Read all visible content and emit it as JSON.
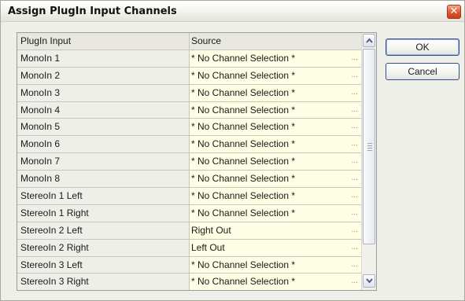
{
  "window": {
    "title": "Assign PlugIn Input Channels",
    "close_glyph": "✕"
  },
  "grid": {
    "headers": {
      "input": "PlugIn Input",
      "source": "Source"
    },
    "ellipsis": "...",
    "rows": [
      {
        "input": "MonoIn 1",
        "source": "* No Channel Selection *"
      },
      {
        "input": "MonoIn 2",
        "source": "* No Channel Selection *"
      },
      {
        "input": "MonoIn 3",
        "source": "* No Channel Selection *"
      },
      {
        "input": "MonoIn 4",
        "source": "* No Channel Selection *"
      },
      {
        "input": "MonoIn 5",
        "source": "* No Channel Selection *"
      },
      {
        "input": "MonoIn 6",
        "source": "* No Channel Selection *"
      },
      {
        "input": "MonoIn 7",
        "source": "* No Channel Selection *"
      },
      {
        "input": "MonoIn 8",
        "source": "* No Channel Selection *"
      },
      {
        "input": "StereoIn 1 Left",
        "source": "* No Channel Selection *"
      },
      {
        "input": "StereoIn 1 Right",
        "source": "* No Channel Selection *"
      },
      {
        "input": "StereoIn 2 Left",
        "source": "Right Out"
      },
      {
        "input": "StereoIn 2 Right",
        "source": "Left Out"
      },
      {
        "input": "StereoIn 3 Left",
        "source": "* No Channel Selection *"
      },
      {
        "input": "StereoIn 3 Right",
        "source": "* No Channel Selection *"
      }
    ]
  },
  "buttons": {
    "ok": "OK",
    "cancel": "Cancel"
  },
  "icons": {
    "scroll_up": "chevron-up-icon",
    "scroll_down": "chevron-down-icon",
    "close": "close-icon"
  },
  "colors": {
    "source_cell_bg": "#fefee4",
    "close_button": "#d9532c",
    "default_button_border": "#2f4f86"
  }
}
